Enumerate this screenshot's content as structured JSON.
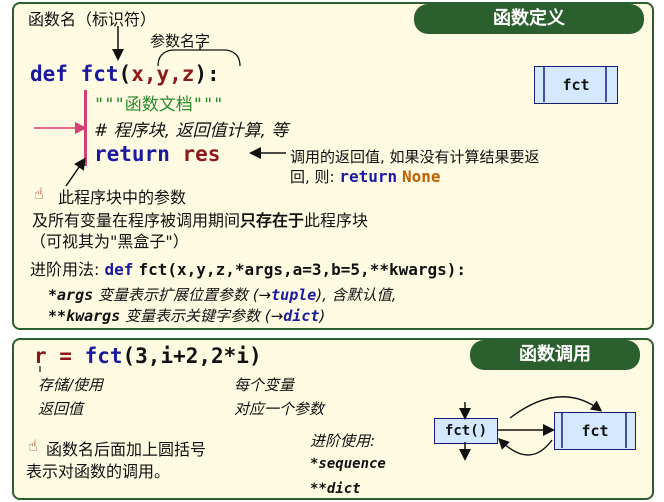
{
  "definition": {
    "title": "函数定义",
    "func_name_label": "函数名（标识符）",
    "params_label": "参数名字",
    "def_kw": "def",
    "fct": "fct",
    "paren_open": "(",
    "params": "x,y,z",
    "paren_close": "):",
    "docstring": "\"\"\"函数文档\"\"\"",
    "comment": "# 程序块, 返回值计算, 等",
    "return_kw": "return",
    "res": "res",
    "return_note_1": "调用的返回值, 如果没有计算结果要返",
    "return_note_2": "回, 则:",
    "return_none_kw": "return",
    "none_val": "None",
    "box_label": "fct",
    "note_local_1": "此程序块中的参数",
    "note_local_2a": "及所有变量在程序被调用期间",
    "note_local_2b": "只存在于",
    "note_local_2c": "此程序块",
    "note_local_3": "（可视其为\"黑盒子\"）",
    "advanced_label": "进阶用法:",
    "advanced_def": "def",
    "advanced_sig": "fct(x,y,z,*args,a=3,b=5,**kwargs):",
    "args_name": "*args",
    "args_desc_1": "变量表示扩展位置参数 (→",
    "args_type": "tuple",
    "args_desc_2": "), 含默认值,",
    "kwargs_name": "**kwargs",
    "kwargs_desc_1": "变量表示关键字参数 (→",
    "kwargs_type": "dict",
    "kwargs_desc_2": ")"
  },
  "call": {
    "title": "函数调用",
    "r_code_1": "r = ",
    "r_code_fct": "fct",
    "r_code_2": "(3,i+2,2*i)",
    "store_use": "存储/使用",
    "return_value": "返回值",
    "each_variable": "每个变量",
    "each_param": "对应一个参数",
    "advanced_use": "进阶使用:",
    "seq": "*sequence",
    "dict": "**dict",
    "note_paren_1": "函数名后面加上圆括号",
    "note_paren_2": "表示对函数的调用。",
    "box_call": "fct()",
    "box_fct": "fct"
  },
  "colors": {
    "panel_border": "#2c5f2e",
    "panel_fill": "#fffbe3",
    "box_fill": "#d4e8ff",
    "keyword": "#1a1aa0",
    "string": "#2a8a2a",
    "arrow_pink": "#d04070"
  },
  "icons": [
    "hand-point-icon",
    "hand-point-icon"
  ]
}
